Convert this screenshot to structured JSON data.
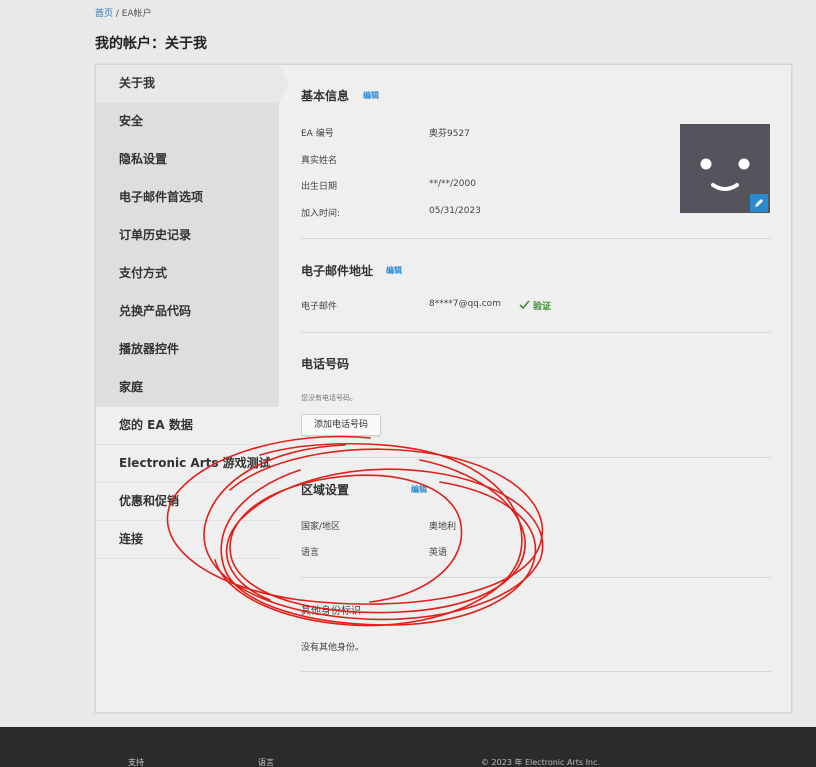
{
  "breadcrumb": {
    "home": "首页",
    "separator": " / ",
    "current": "EA帐户"
  },
  "page_title": "我的帐户：关于我",
  "sidebar": {
    "items": [
      {
        "label": "关于我"
      },
      {
        "label": "安全"
      },
      {
        "label": "隐私设置"
      },
      {
        "label": "电子邮件首选项"
      },
      {
        "label": "订单历史记录"
      },
      {
        "label": "支付方式"
      },
      {
        "label": "兑换产品代码"
      },
      {
        "label": "播放器控件"
      },
      {
        "label": "家庭"
      },
      {
        "label": "您的 EA 数据"
      },
      {
        "label": "Electronic Arts 游戏测试"
      },
      {
        "label": "优惠和促销"
      },
      {
        "label": "连接"
      }
    ]
  },
  "basic_info": {
    "title": "基本信息",
    "edit": "编辑",
    "ea_id_label": "EA 编号",
    "ea_id_value": "奥芬9527",
    "real_name_label": "真实姓名",
    "birth_label": "出生日期",
    "birth_value": "**/**/2000",
    "join_label": "加入时间:",
    "join_value": "05/31/2023"
  },
  "email": {
    "title": "电子邮件地址",
    "edit": "编辑",
    "label": "电子邮件",
    "value": "8****7@qq.com",
    "verified": "验证"
  },
  "phone": {
    "title": "电话号码",
    "note": "您没有电话号码。",
    "add_button": "添加电话号码"
  },
  "region": {
    "title": "区域设置",
    "edit": "编辑",
    "country_label": "国家/地区",
    "country_value": "奥地利",
    "language_label": "语言",
    "language_value": "英语"
  },
  "other_identities": {
    "title": "其他身份标识",
    "note": "没有其他身份。"
  },
  "footer": {
    "link1": "支持",
    "link2": "语言",
    "copyright": "© 2023 年 Electronic Arts Inc."
  },
  "colors": {
    "accent": "#2a8ad0",
    "verified": "#3b8f35",
    "scribble": "#e0201a",
    "avatar_bg": "#55545c"
  }
}
